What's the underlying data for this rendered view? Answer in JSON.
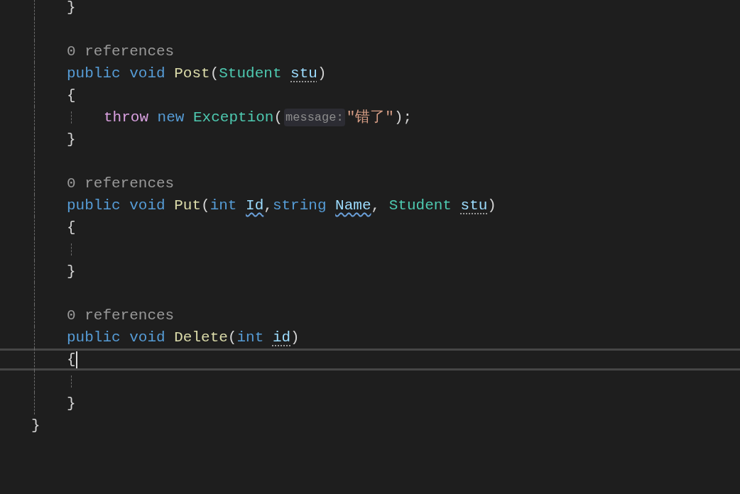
{
  "editor": {
    "lines": [
      {
        "kind": "member",
        "current": false,
        "tokens": [
          {
            "text": "}",
            "kind": "punct"
          }
        ]
      },
      {
        "kind": "blank",
        "current": false
      },
      {
        "kind": "codelens",
        "current": false,
        "tokens": [
          {
            "text": "0 references",
            "kind": "codelens"
          }
        ]
      },
      {
        "kind": "member",
        "current": false,
        "tokens": [
          {
            "text": "public",
            "kind": "keyword"
          },
          {
            "text": "void",
            "kind": "keyword",
            "space_before": true
          },
          {
            "text": "Post",
            "kind": "method",
            "space_before": true
          },
          {
            "text": "(",
            "kind": "punct"
          },
          {
            "text": "Student",
            "kind": "type"
          },
          {
            "text": "stu",
            "kind": "param",
            "space_before": true,
            "squiggle": false,
            "dots": true
          },
          {
            "text": ")",
            "kind": "punct"
          }
        ]
      },
      {
        "kind": "member",
        "current": false,
        "tokens": [
          {
            "text": "{",
            "kind": "punct"
          }
        ]
      },
      {
        "kind": "body",
        "current": false,
        "tokens": [
          {
            "text": "throw",
            "kind": "control"
          },
          {
            "text": "new",
            "kind": "keyword",
            "space_before": true
          },
          {
            "text": "Exception",
            "kind": "type",
            "space_before": true
          },
          {
            "text": "(",
            "kind": "punct"
          },
          {
            "text": "message:",
            "kind": "hint"
          },
          {
            "text": "\"错了\"",
            "kind": "string"
          },
          {
            "text": ");",
            "kind": "punct"
          }
        ]
      },
      {
        "kind": "member",
        "current": false,
        "tokens": [
          {
            "text": "}",
            "kind": "punct"
          }
        ]
      },
      {
        "kind": "blank",
        "current": false
      },
      {
        "kind": "codelens",
        "current": false,
        "tokens": [
          {
            "text": "0 references",
            "kind": "codelens"
          }
        ]
      },
      {
        "kind": "member",
        "current": false,
        "tokens": [
          {
            "text": "public",
            "kind": "keyword"
          },
          {
            "text": "void",
            "kind": "keyword",
            "space_before": true
          },
          {
            "text": "Put",
            "kind": "method",
            "space_before": true
          },
          {
            "text": "(",
            "kind": "punct"
          },
          {
            "text": "int",
            "kind": "keyword"
          },
          {
            "text": "Id",
            "kind": "param",
            "space_before": true,
            "squiggle": true,
            "dots": false
          },
          {
            "text": ",",
            "kind": "punct"
          },
          {
            "text": "string",
            "kind": "keyword"
          },
          {
            "text": "Name",
            "kind": "param",
            "space_before": true,
            "squiggle": true,
            "dots": false
          },
          {
            "text": ",",
            "kind": "punct"
          },
          {
            "text": "Student",
            "kind": "type",
            "space_before": true
          },
          {
            "text": "stu",
            "kind": "param",
            "space_before": true,
            "squiggle": false,
            "dots": true
          },
          {
            "text": ")",
            "kind": "punct"
          }
        ]
      },
      {
        "kind": "member",
        "current": false,
        "tokens": [
          {
            "text": "{",
            "kind": "punct"
          }
        ]
      },
      {
        "kind": "body_blank",
        "current": false
      },
      {
        "kind": "member",
        "current": false,
        "tokens": [
          {
            "text": "}",
            "kind": "punct"
          }
        ]
      },
      {
        "kind": "blank",
        "current": false
      },
      {
        "kind": "codelens",
        "current": false,
        "tokens": [
          {
            "text": "0 references",
            "kind": "codelens"
          }
        ]
      },
      {
        "kind": "member",
        "current": false,
        "tokens": [
          {
            "text": "public",
            "kind": "keyword"
          },
          {
            "text": "void",
            "kind": "keyword",
            "space_before": true
          },
          {
            "text": "Delete",
            "kind": "method",
            "space_before": true
          },
          {
            "text": "(",
            "kind": "punct"
          },
          {
            "text": "int",
            "kind": "keyword"
          },
          {
            "text": "id",
            "kind": "param",
            "space_before": true,
            "squiggle": false,
            "dots": true
          },
          {
            "text": ")",
            "kind": "punct"
          }
        ]
      },
      {
        "kind": "member",
        "current": true,
        "tokens": [
          {
            "text": "{",
            "kind": "punct"
          }
        ]
      },
      {
        "kind": "body_blank",
        "current": false
      },
      {
        "kind": "member",
        "current": false,
        "tokens": [
          {
            "text": "}",
            "kind": "punct"
          }
        ]
      },
      {
        "kind": "outer",
        "current": false,
        "tokens": [
          {
            "text": "}",
            "kind": "punct"
          }
        ]
      }
    ]
  }
}
